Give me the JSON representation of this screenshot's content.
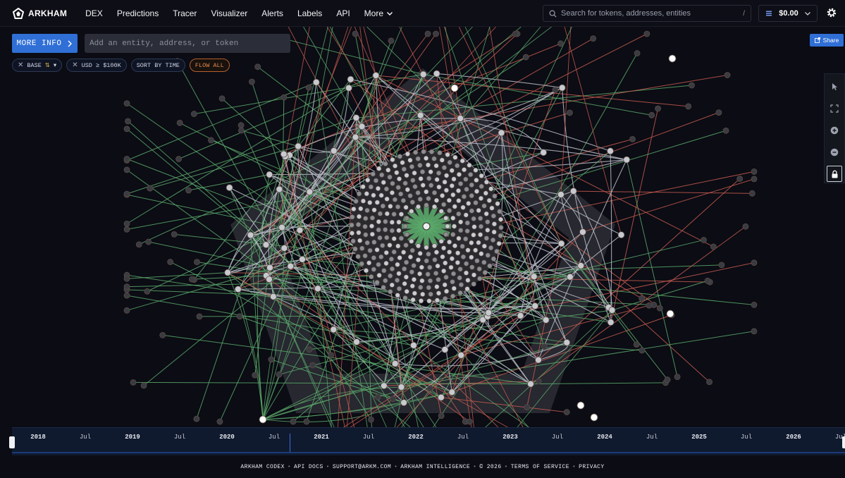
{
  "brand": {
    "name": "ARKHAM"
  },
  "nav": {
    "items": [
      "DEX",
      "Predictions",
      "Tracer",
      "Visualizer",
      "Alerts",
      "Labels",
      "API"
    ],
    "more_label": "More"
  },
  "search": {
    "placeholder": "Search for tokens, addresses, entities",
    "shortcut": "/"
  },
  "balance": {
    "value": "$0.00"
  },
  "controls": {
    "more_info_label": "MORE INFO",
    "entity_placeholder": "Add an entity, address, or token",
    "filters": {
      "chain": "BASE",
      "usd": "USD ≥ $100K",
      "sort": "SORT BY TIME",
      "flow": "FLOW ALL"
    },
    "share_label": "Share"
  },
  "timeline": {
    "ticks": [
      "2018",
      "Jul",
      "2019",
      "Jul",
      "2020",
      "Jul",
      "2021",
      "Jul",
      "2022",
      "Jul",
      "2023",
      "Jul",
      "2024",
      "Jul",
      "2025",
      "Jul",
      "2026",
      "Jul"
    ]
  },
  "footer": {
    "codex": "ARKHAM CODEX",
    "api_docs": "API DOCS",
    "support": "SUPPORT@ARKM.COM",
    "intel": "ARKHAM INTELLIGENCE",
    "copyright": "© 2026",
    "terms": "TERMS OF SERVICE",
    "privacy": "PRIVACY"
  },
  "colors": {
    "accent": "#2f6fd6",
    "inflow_edge": "#5aa86a",
    "outflow_edge": "#c45a4e",
    "neutral_edge": "#b9bcc6",
    "flow_chip": "#e08a4e"
  },
  "icons": {
    "logo": "arkham-logo-icon",
    "search": "search-icon",
    "gear": "gear-icon",
    "pointer": "cursor-icon",
    "fit": "fit-screen-icon",
    "zoom_in": "zoom-in-icon",
    "zoom_out": "zoom-out-icon",
    "lock": "lock-icon"
  }
}
